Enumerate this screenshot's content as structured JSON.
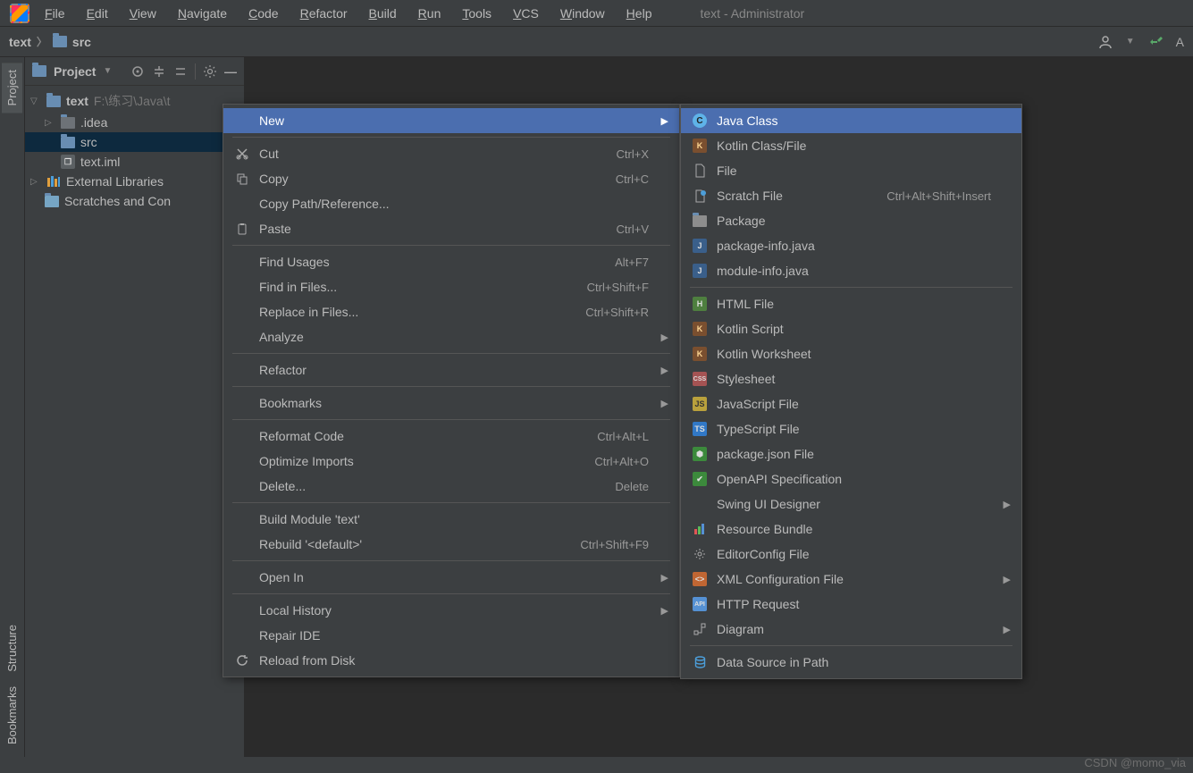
{
  "window_title": "text - Administrator",
  "menubar": [
    "File",
    "Edit",
    "View",
    "Navigate",
    "Code",
    "Refactor",
    "Build",
    "Run",
    "Tools",
    "VCS",
    "Window",
    "Help"
  ],
  "breadcrumb": {
    "root": "text",
    "child": "src",
    "right_letter": "A"
  },
  "gutter": {
    "project": "Project",
    "structure": "Structure",
    "bookmarks": "Bookmarks"
  },
  "panel": {
    "title": "Project"
  },
  "tree": {
    "root_name": "text",
    "root_path": "F:\\练习\\Java\\t",
    "idea": ".idea",
    "src": "src",
    "iml": "text.iml",
    "external": "External Libraries",
    "scratches": "Scratches and Con"
  },
  "context_menu": [
    {
      "label": "New",
      "sub": true,
      "highlight": true
    },
    {
      "sep": true
    },
    {
      "label": "Cut",
      "icon": "cut",
      "shortcut": "Ctrl+X"
    },
    {
      "label": "Copy",
      "icon": "copy",
      "shortcut": "Ctrl+C"
    },
    {
      "label": "Copy Path/Reference..."
    },
    {
      "label": "Paste",
      "icon": "paste",
      "shortcut": "Ctrl+V"
    },
    {
      "sep": true
    },
    {
      "label": "Find Usages",
      "shortcut": "Alt+F7"
    },
    {
      "label": "Find in Files...",
      "shortcut": "Ctrl+Shift+F"
    },
    {
      "label": "Replace in Files...",
      "shortcut": "Ctrl+Shift+R"
    },
    {
      "label": "Analyze",
      "sub": true
    },
    {
      "sep": true
    },
    {
      "label": "Refactor",
      "sub": true
    },
    {
      "sep": true
    },
    {
      "label": "Bookmarks",
      "sub": true
    },
    {
      "sep": true
    },
    {
      "label": "Reformat Code",
      "shortcut": "Ctrl+Alt+L"
    },
    {
      "label": "Optimize Imports",
      "shortcut": "Ctrl+Alt+O"
    },
    {
      "label": "Delete...",
      "shortcut": "Delete"
    },
    {
      "sep": true
    },
    {
      "label": "Build Module 'text'"
    },
    {
      "label": "Rebuild '<default>'",
      "shortcut": "Ctrl+Shift+F9"
    },
    {
      "sep": true
    },
    {
      "label": "Open In",
      "sub": true
    },
    {
      "sep": true
    },
    {
      "label": "Local History",
      "sub": true
    },
    {
      "label": "Repair IDE"
    },
    {
      "label": "Reload from Disk",
      "icon": "reload"
    }
  ],
  "new_menu": [
    {
      "label": "Java Class",
      "icon": "c-blue",
      "highlight": true
    },
    {
      "label": "Kotlin Class/File",
      "icon": "k"
    },
    {
      "label": "File",
      "icon": "file"
    },
    {
      "label": "Scratch File",
      "icon": "scratch",
      "shortcut": "Ctrl+Alt+Shift+Insert"
    },
    {
      "label": "Package",
      "icon": "folder"
    },
    {
      "label": "package-info.java",
      "icon": "j"
    },
    {
      "label": "module-info.java",
      "icon": "j"
    },
    {
      "sep": true
    },
    {
      "label": "HTML File",
      "icon": "h"
    },
    {
      "label": "Kotlin Script",
      "icon": "k"
    },
    {
      "label": "Kotlin Worksheet",
      "icon": "k"
    },
    {
      "label": "Stylesheet",
      "icon": "css"
    },
    {
      "label": "JavaScript File",
      "icon": "js"
    },
    {
      "label": "TypeScript File",
      "icon": "ts"
    },
    {
      "label": "package.json File",
      "icon": "pj"
    },
    {
      "label": "OpenAPI Specification",
      "icon": "api"
    },
    {
      "label": "Swing UI Designer",
      "sub": true
    },
    {
      "label": "Resource Bundle",
      "icon": "rb"
    },
    {
      "label": "EditorConfig File",
      "icon": "gear"
    },
    {
      "label": "XML Configuration File",
      "icon": "xml",
      "sub": true
    },
    {
      "label": "HTTP Request",
      "icon": "http"
    },
    {
      "label": "Diagram",
      "icon": "diag",
      "sub": true
    },
    {
      "sep": true
    },
    {
      "label": "Data Source in Path",
      "icon": "db"
    }
  ],
  "watermark": "CSDN @momo_via"
}
